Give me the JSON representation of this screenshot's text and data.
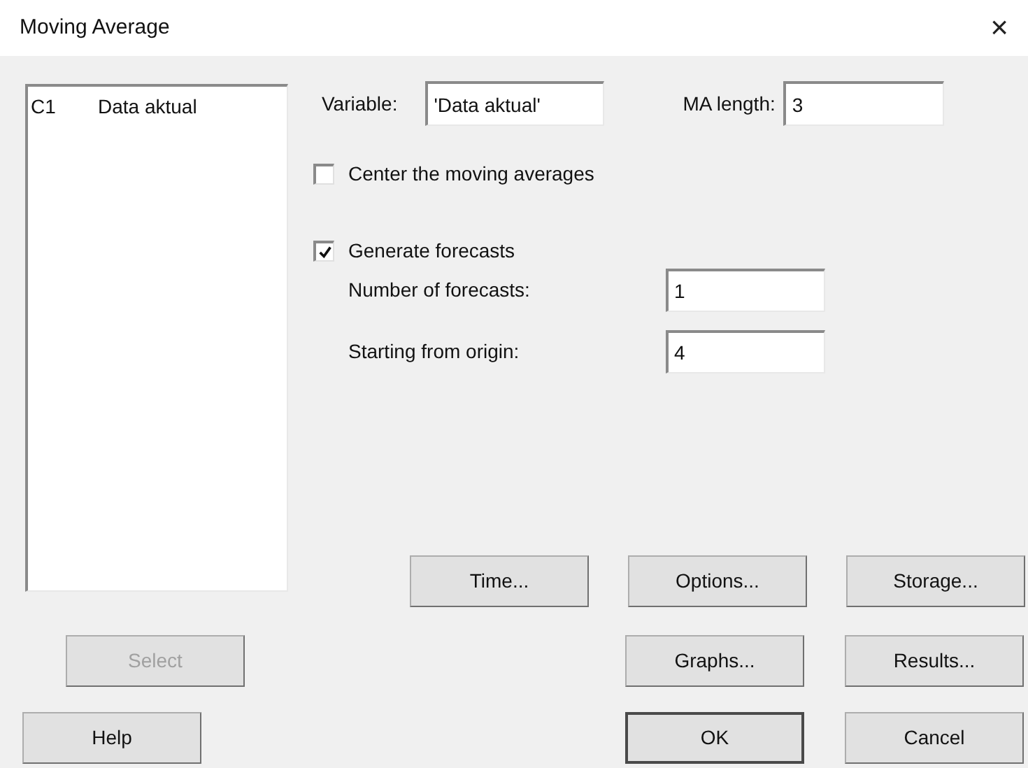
{
  "window": {
    "title": "Moving Average",
    "close": "×"
  },
  "variables": [
    {
      "column": "C1",
      "name": "Data aktual"
    }
  ],
  "variable": {
    "label": "Variable:",
    "value": "'Data aktual'"
  },
  "ma_length": {
    "label": "MA length:",
    "value": "3"
  },
  "center": {
    "label": "Center the moving averages",
    "checked": false
  },
  "forecasts": {
    "label": "Generate forecasts",
    "checked": true
  },
  "number_of_forecasts": {
    "label": "Number of forecasts:",
    "value": "1"
  },
  "starting_from_origin": {
    "label": "Starting from origin:",
    "value": "4"
  },
  "buttons": [
    {
      "label": "Time...",
      "disabled": false,
      "default": false
    },
    {
      "label": "Options...",
      "disabled": false,
      "default": false
    },
    {
      "label": "Storage...",
      "disabled": false,
      "default": false
    },
    {
      "label": "Select",
      "disabled": true,
      "default": false
    },
    {
      "label": "Graphs...",
      "disabled": false,
      "default": false
    },
    {
      "label": "Results...",
      "disabled": false,
      "default": false
    },
    {
      "label": "Help",
      "disabled": false,
      "default": false
    },
    {
      "label": "OK",
      "disabled": false,
      "default": true
    },
    {
      "label": "Cancel",
      "disabled": false,
      "default": false
    }
  ]
}
